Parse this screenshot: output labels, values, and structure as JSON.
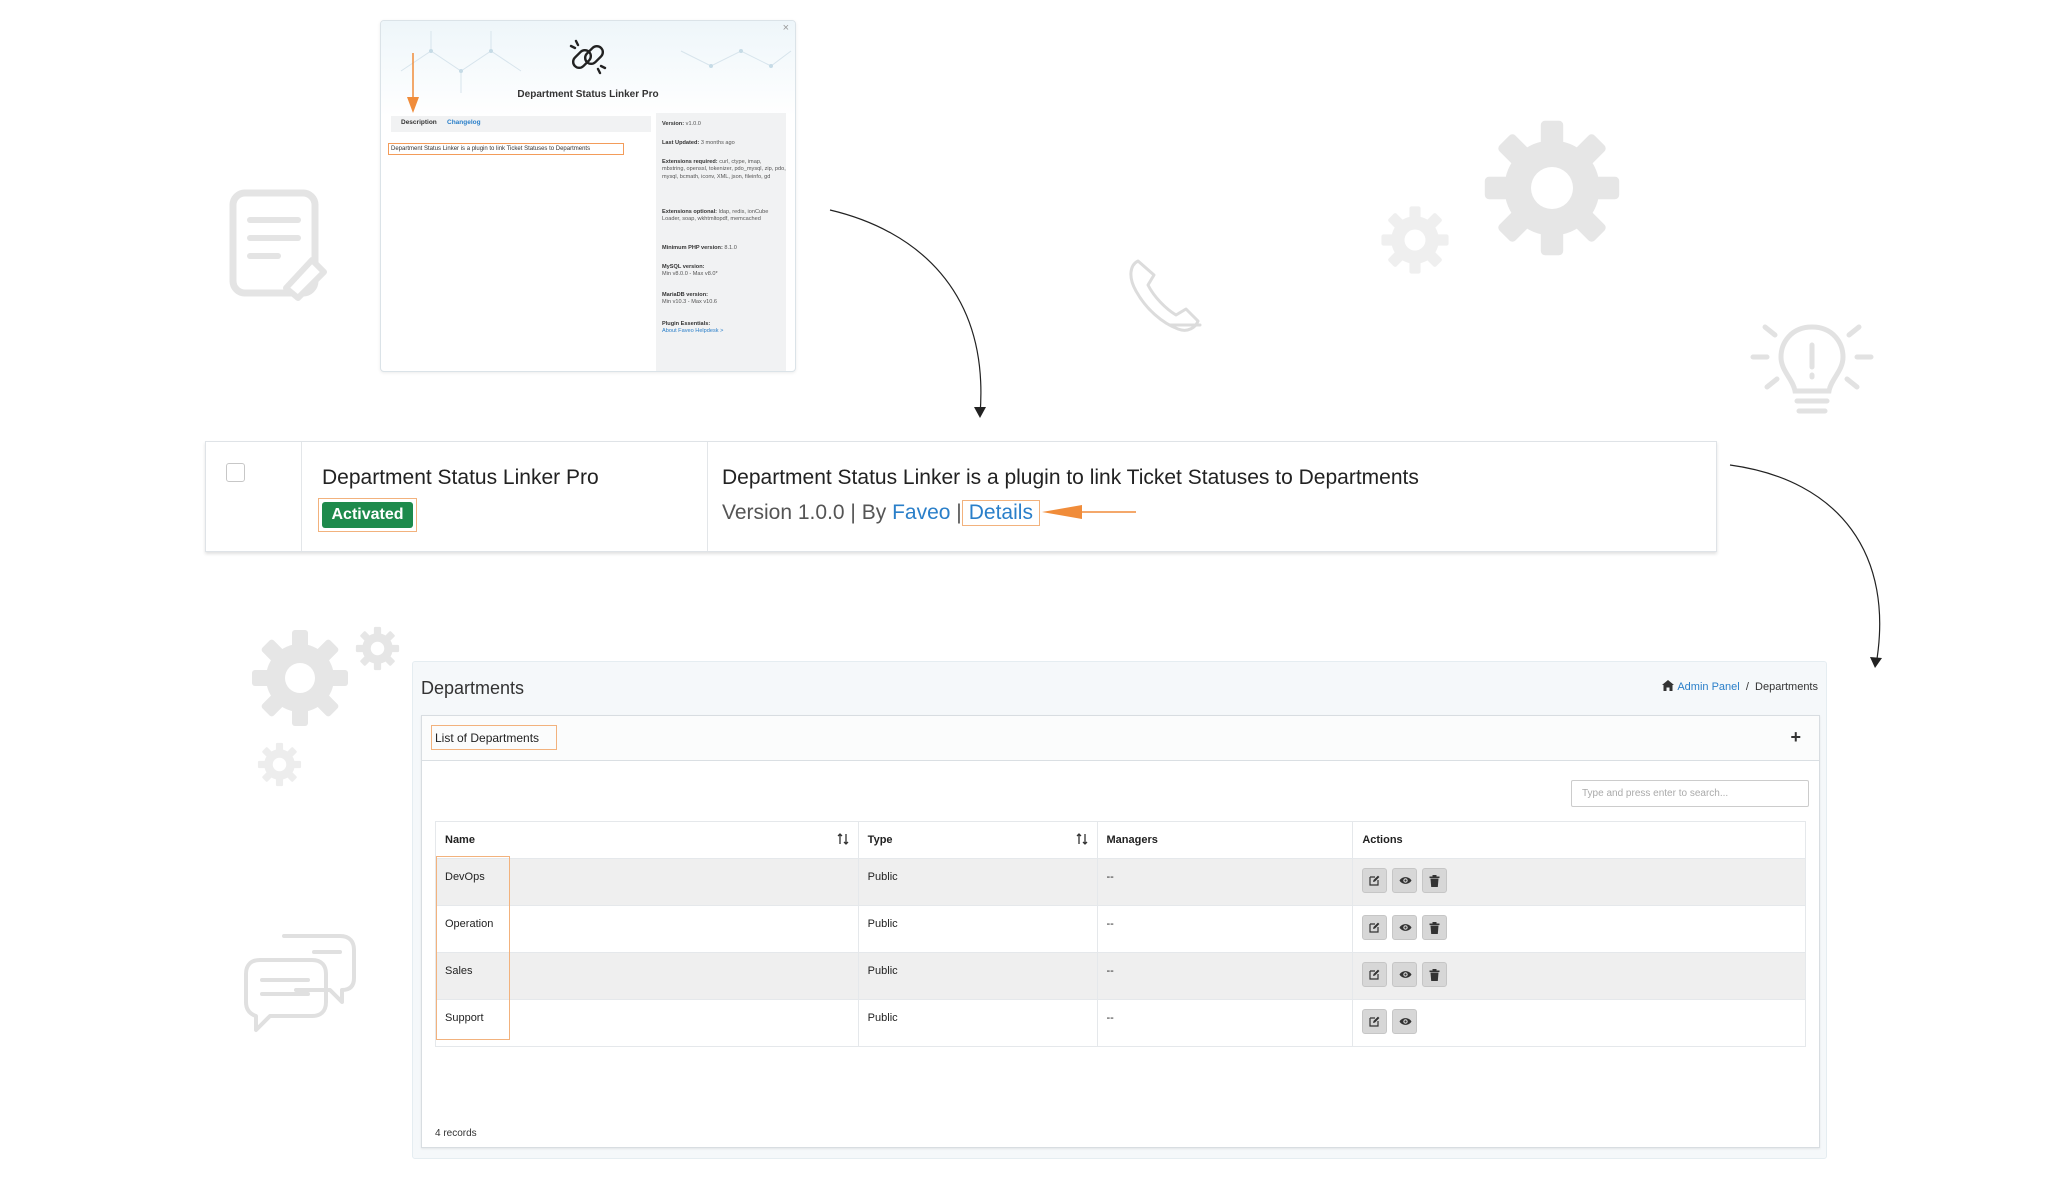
{
  "modal": {
    "close": "×",
    "title": "Department Status Linker Pro",
    "tabs": [
      "Description",
      "Changelog"
    ],
    "description": "Department Status Linker is a plugin to link Ticket Statuses to Departments",
    "side": {
      "version_label": "Version:",
      "version_value": "v1.0.0",
      "updated_label": "Last Updated:",
      "updated_value": "3 months ago",
      "ext_req_label": "Extensions required:",
      "ext_req_value": "curl, ctype, imap, mbstring, openssl, tokenizer, pdo_mysql, zip, pdo, mysql, bcmath, iconv, XML, json, fileinfo, gd",
      "ext_opt_label": "Extensions optional:",
      "ext_opt_value": "ldap, redis, ionCube Loader, soap, wkhtmltopdf, memcached",
      "php_label": "Minimum PHP version:",
      "php_value": "8.1.0",
      "mysql_label": "MySQL version:",
      "mysql_value": "Min v8.0.0 - Max v8.0*",
      "mariadb_label": "MariaDB version:",
      "mariadb_value": "Min v10.3 - Max v10.6",
      "essentials_label": "Plugin Essentials:",
      "essentials_link": "About Faveo Helpdesk >"
    }
  },
  "plugin": {
    "name": "Department Status Linker Pro",
    "status": "Activated",
    "description": "Department Status Linker is a plugin to link Ticket Statuses to Departments",
    "version_text": "Version 1.0.0 | By ",
    "author": "Faveo",
    "separator": "|",
    "details": "Details"
  },
  "departments": {
    "page_title": "Departments",
    "breadcrumb": {
      "home": "Admin Panel",
      "separator": "/",
      "current": "Departments"
    },
    "card_title": "List of Departments",
    "add": "+",
    "search_placeholder": "Type and press enter to search...",
    "columns": [
      "Name",
      "Type",
      "Managers",
      "Actions"
    ],
    "rows": [
      {
        "name": "DevOps",
        "type": "Public",
        "managers": "--"
      },
      {
        "name": "Operation",
        "type": "Public",
        "managers": "--"
      },
      {
        "name": "Sales",
        "type": "Public",
        "managers": "--"
      },
      {
        "name": "Support",
        "type": "Public",
        "managers": "--"
      }
    ],
    "records": "4 records"
  },
  "colors": {
    "accent_orange": "#f08c3a",
    "link_blue": "#2a7fc9",
    "badge_green": "#1e8a4c",
    "deco_gray": "#e6e6e6"
  }
}
